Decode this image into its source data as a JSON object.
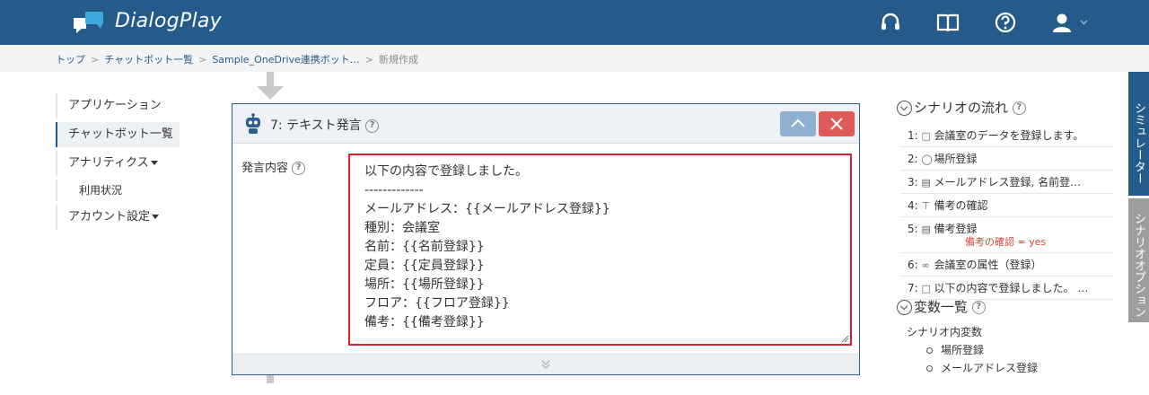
{
  "header": {
    "brand": "DialogPlay",
    "icons": [
      "headset-icon",
      "book-icon",
      "help-icon",
      "user-icon"
    ]
  },
  "breadcrumb": {
    "items": [
      "トップ",
      "チャットボット一覧",
      "Sample_OneDrive連携ボット…"
    ],
    "current": "新規作成"
  },
  "leftnav": {
    "application": "アプリケーション",
    "chatbots": "チャットボット一覧",
    "analytics": "アナリティクス",
    "usage": "利用状況",
    "account": "アカウント設定"
  },
  "panel": {
    "title": "7: テキスト発言",
    "field_label": "発言内容",
    "text_lines": [
      "以下の内容で登録しました。",
      "-------------",
      "メールアドレス：{{メールアドレス登録}}",
      "種別：会議室",
      "名前：{{名前登録}}",
      "定員：{{定員登録}}",
      "場所：{{場所登録}}",
      "フロア：{{フロア登録}}",
      "備考：{{備考登録}}"
    ]
  },
  "scenario": {
    "heading": "シナリオの流れ",
    "items": [
      {
        "num": "1:",
        "icon": "speech-icon",
        "label": "会議室のデータを登録します。"
      },
      {
        "num": "2:",
        "icon": "shield-icon",
        "label": "場所登録"
      },
      {
        "num": "3:",
        "icon": "form-icon",
        "label": "メールアドレス登録, 名前登…"
      },
      {
        "num": "4:",
        "icon": "branch-icon",
        "label": "備考の確認"
      },
      {
        "num": "5:",
        "icon": "form-icon",
        "label": "備考登録",
        "condition": "備考の確認 = yes"
      },
      {
        "num": "6:",
        "icon": "link-icon",
        "label": "会議室の属性（登録）"
      },
      {
        "num": "7:",
        "icon": "speech-icon",
        "label": "以下の内容で登録しました。 …"
      }
    ]
  },
  "variables": {
    "heading": "変数一覧",
    "scope": "シナリオ内変数",
    "items": [
      "場所登録",
      "メールアドレス登録"
    ]
  },
  "side_tabs": {
    "simulator": "シミュレーター",
    "options": "シナリオオプション"
  },
  "colors": {
    "header": "#245b8a",
    "accent_red": "#d9232d",
    "button_up": "#8fb0d1",
    "button_close": "#e05a5a"
  }
}
